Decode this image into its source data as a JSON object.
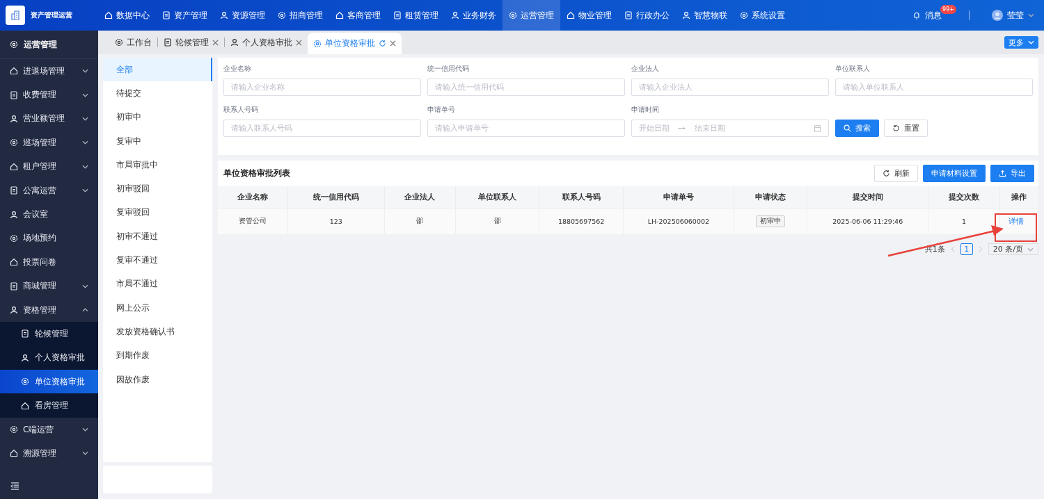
{
  "top_nav": {
    "app_name": "资产管理运营",
    "menu": [
      {
        "label": "数据中心",
        "selected": false
      },
      {
        "label": "资产管理",
        "selected": false
      },
      {
        "label": "资源管理",
        "selected": false
      },
      {
        "label": "招商管理",
        "selected": false
      },
      {
        "label": "客商管理",
        "selected": false
      },
      {
        "label": "租赁管理",
        "selected": false
      },
      {
        "label": "业务财务",
        "selected": false
      },
      {
        "label": "运营管理",
        "selected": true
      },
      {
        "label": "物业管理",
        "selected": false
      },
      {
        "label": "行政办公",
        "selected": false
      },
      {
        "label": "智慧物联",
        "selected": false
      },
      {
        "label": "系统设置",
        "selected": false
      }
    ],
    "messages": {
      "label": "消息",
      "badge": "99+"
    },
    "user": {
      "name": "莹莹"
    }
  },
  "tabs": [
    {
      "label": "工作台",
      "selected": false,
      "closable": false
    },
    {
      "label": "轮候管理",
      "selected": false,
      "closable": true
    },
    {
      "label": "个人资格审批",
      "selected": false,
      "closable": true
    },
    {
      "label": "单位资格审批",
      "selected": true,
      "closable": true
    }
  ],
  "more_button": "更多",
  "sidebar": {
    "title": "运营管理",
    "items": [
      {
        "label": "进退场管理",
        "kind": "group",
        "expanded": false
      },
      {
        "label": "收费管理",
        "kind": "group",
        "expanded": false
      },
      {
        "label": "营业额管理",
        "kind": "group",
        "expanded": false
      },
      {
        "label": "巡场管理",
        "kind": "group",
        "expanded": false
      },
      {
        "label": "租户管理",
        "kind": "group",
        "expanded": false
      },
      {
        "label": "公寓运营",
        "kind": "group",
        "expanded": false
      },
      {
        "label": "会议室",
        "kind": "link"
      },
      {
        "label": "场地预约",
        "kind": "link"
      },
      {
        "label": "投票问卷",
        "kind": "link"
      },
      {
        "label": "商城管理",
        "kind": "group",
        "expanded": false
      },
      {
        "label": "资格管理",
        "kind": "group",
        "expanded": true,
        "children": [
          {
            "label": "轮候管理",
            "selected": false
          },
          {
            "label": "个人资格审批",
            "selected": false
          },
          {
            "label": "单位资格审批",
            "selected": true
          },
          {
            "label": "看房管理",
            "selected": false
          }
        ]
      },
      {
        "label": "C端运营",
        "kind": "group",
        "expanded": false
      },
      {
        "label": "溯源管理",
        "kind": "group",
        "expanded": false
      }
    ]
  },
  "status_filter": [
    {
      "label": "全部",
      "selected": true
    },
    {
      "label": "待提交",
      "selected": false
    },
    {
      "label": "初审中",
      "selected": false
    },
    {
      "label": "复审中",
      "selected": false
    },
    {
      "label": "市局审批中",
      "selected": false
    },
    {
      "label": "初审驳回",
      "selected": false
    },
    {
      "label": "复审驳回",
      "selected": false
    },
    {
      "label": "初审不通过",
      "selected": false
    },
    {
      "label": "复审不通过",
      "selected": false
    },
    {
      "label": "市局不通过",
      "selected": false
    },
    {
      "label": "网上公示",
      "selected": false
    },
    {
      "label": "发放资格确认书",
      "selected": false
    },
    {
      "label": "到期作废",
      "selected": false
    },
    {
      "label": "因故作废",
      "selected": false
    }
  ],
  "search_form": {
    "fields": [
      {
        "label": "企业名称",
        "placeholder": "请输入企业名称"
      },
      {
        "label": "统一信用代码",
        "placeholder": "请输入统一信用代码"
      },
      {
        "label": "企业法人",
        "placeholder": "请输入企业法人"
      },
      {
        "label": "单位联系人",
        "placeholder": "请输入单位联系人"
      },
      {
        "label": "联系人号码",
        "placeholder": "请输入联系人号码"
      },
      {
        "label": "申请单号",
        "placeholder": "请输入申请单号"
      }
    ],
    "date_range": {
      "label": "申请时间",
      "start_placeholder": "开始日期",
      "end_placeholder": "结束日期"
    },
    "search_button": "搜索",
    "reset_button": "重置"
  },
  "table": {
    "title": "单位资格审批列表",
    "actions": [
      {
        "label": "刷新",
        "kind": "refresh"
      },
      {
        "label": "申请材料设置",
        "kind": "primary"
      },
      {
        "label": "导出",
        "kind": "export"
      }
    ],
    "columns": [
      "企业名称",
      "统一信用代码",
      "企业法人",
      "单位联系人",
      "联系人号码",
      "申请单号",
      "申请状态",
      "提交时间",
      "提交次数",
      "操作"
    ],
    "rows": [
      {
        "cells": [
          "资管公司",
          "123",
          "邵",
          "邵",
          "18805697562",
          "LH-202506060002"
        ],
        "status": "初审中",
        "submitted": "2025-06-06 11:29:46",
        "count": "1",
        "action": "详情"
      }
    ]
  },
  "pagination": {
    "total": "共1条",
    "pages": [
      {
        "label": "1",
        "selected": true
      }
    ],
    "page_size": "20 条/页"
  }
}
